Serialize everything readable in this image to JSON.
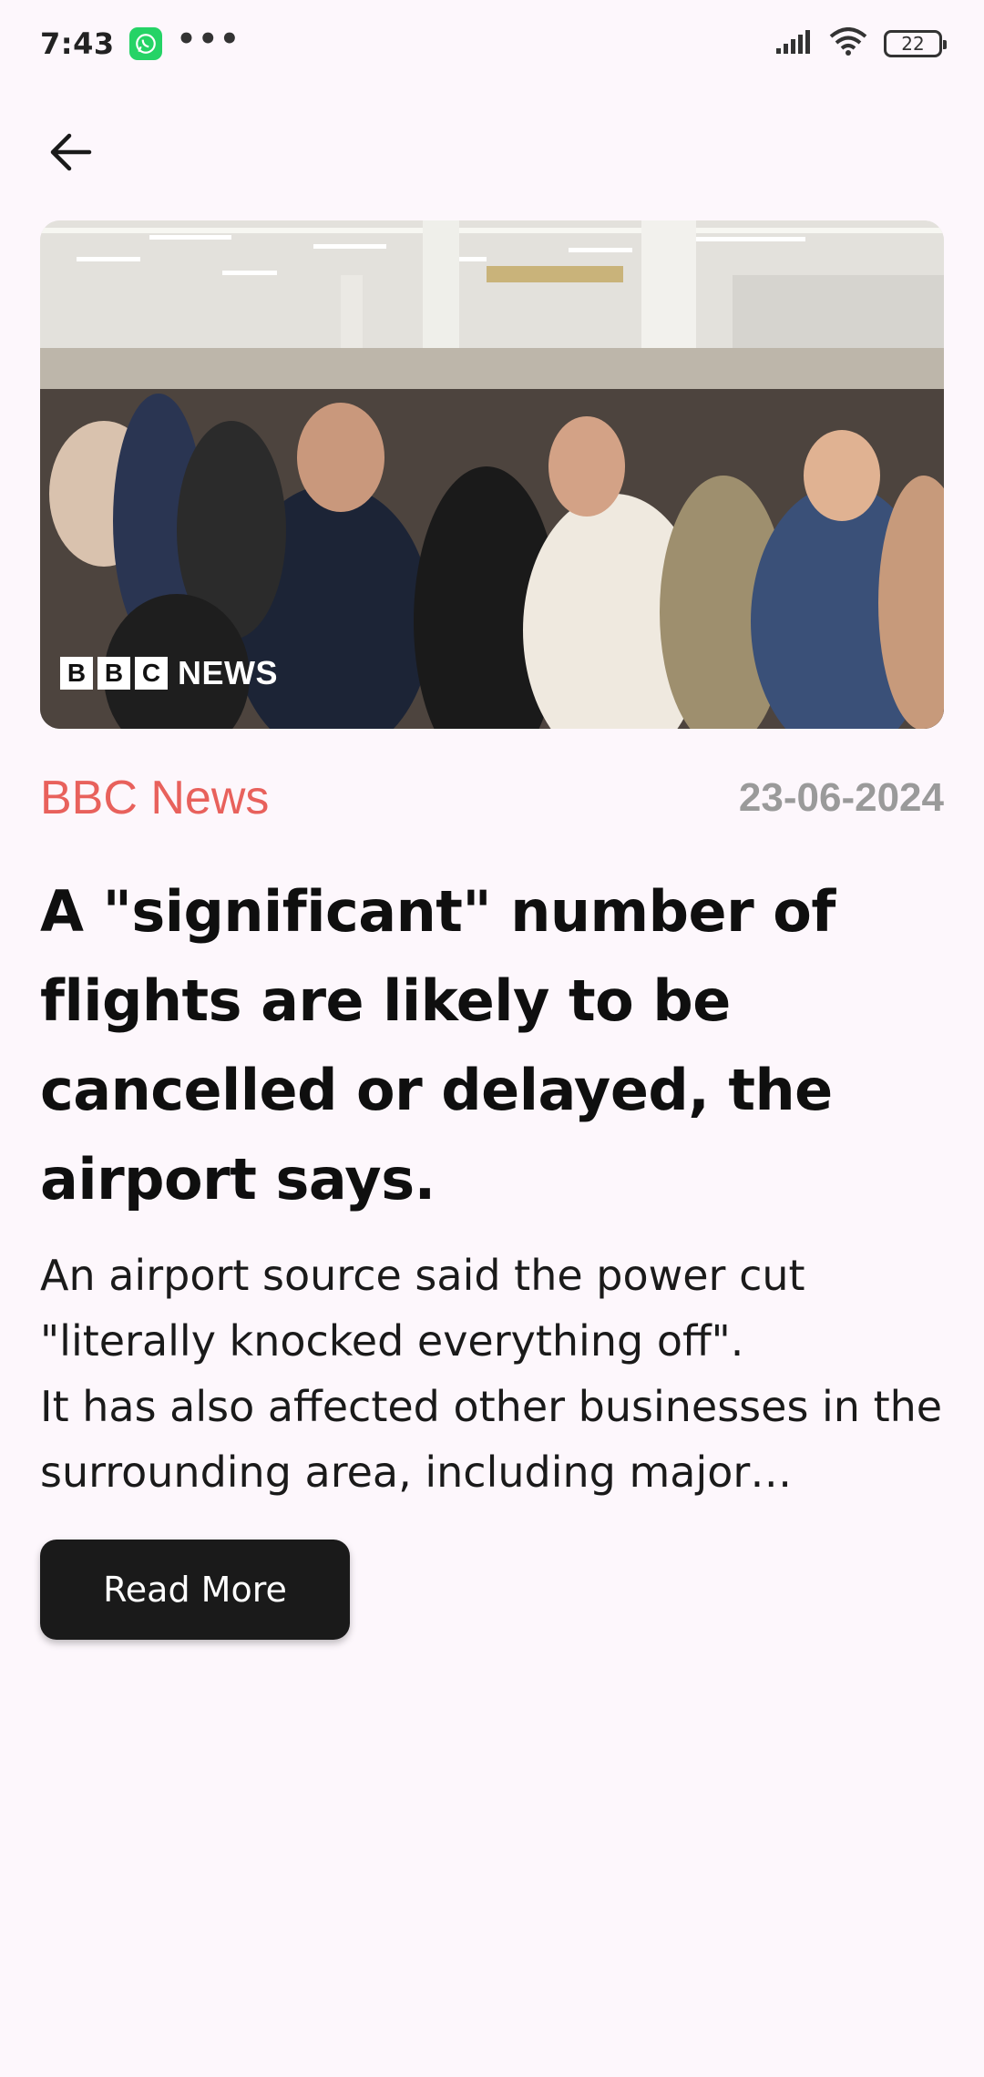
{
  "status_bar": {
    "time": "7:43",
    "dots": "•••",
    "battery": "22"
  },
  "article": {
    "image_logo": {
      "letters": [
        "B",
        "B",
        "C"
      ],
      "news": "NEWS"
    },
    "source": "BBC News",
    "date": "23-06-2024",
    "headline": "A \"significant\" number of flights are likely to be cancelled or delayed, the airport says.",
    "body": "An airport source said the power cut \"literally knocked everything off\".\nIt has also affected other businesses in the surrounding area, including major…",
    "read_more_label": "Read More"
  },
  "colors": {
    "source": "#e8615c",
    "date": "#9a9a9a",
    "button_bg": "#1a1a1a",
    "background": "#fdf7fc"
  }
}
